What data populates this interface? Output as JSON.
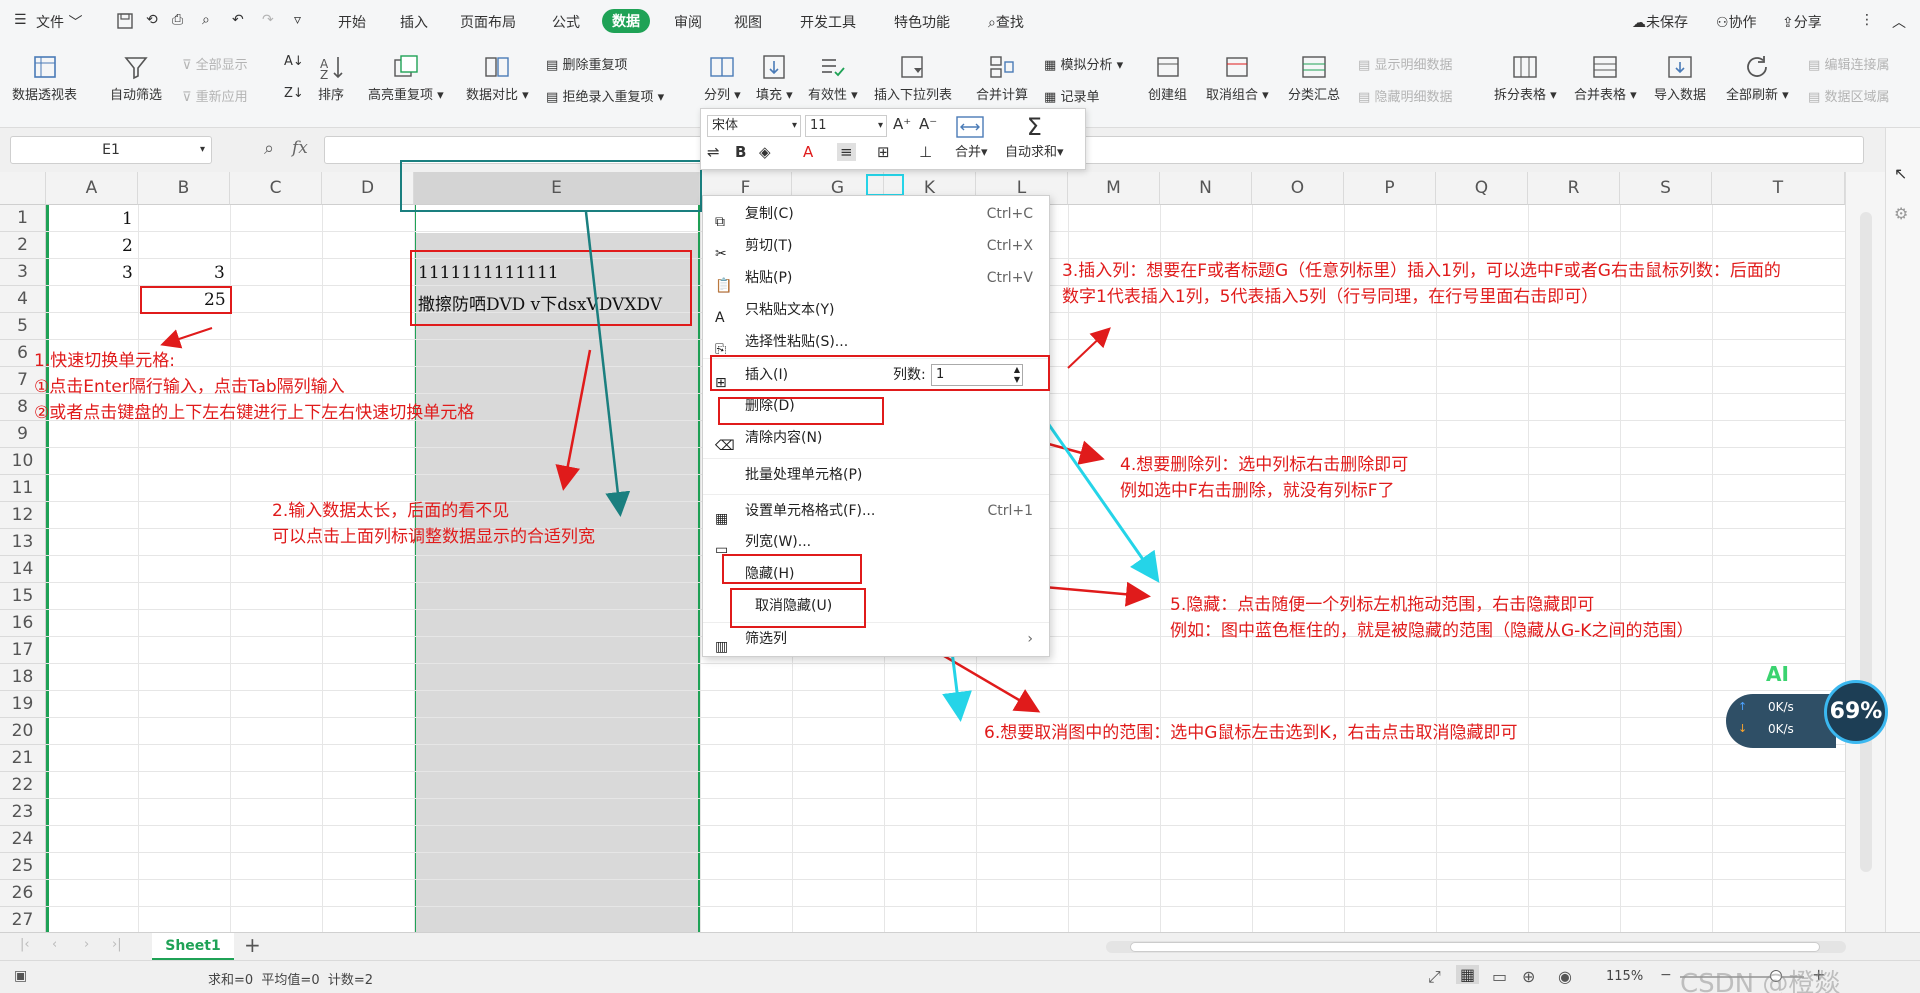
{
  "menu": {
    "file": "文件",
    "tabs": [
      "开始",
      "插入",
      "页面布局",
      "公式",
      "数据",
      "审阅",
      "视图",
      "开发工具",
      "特色功能"
    ],
    "active_tab": "数据",
    "search": "查找",
    "unsaved": "未保存",
    "collab": "协作",
    "share": "分享"
  },
  "ribbon": {
    "pivot": "数据透视表",
    "autofilter": "自动筛选",
    "show_all": "全部显示",
    "reapply": "重新应用",
    "sort": "排序",
    "highlight_dup": "高亮重复项",
    "compare": "数据对比",
    "remove_dup": "删除重复项",
    "reject_dup": "拒绝录入重复项",
    "split": "分列",
    "fill": "填充",
    "validity": "有效性",
    "dropdown": "插入下拉列表",
    "consolidate": "合并计算",
    "simulate": "模拟分析",
    "record": "记录单",
    "group": "创建组",
    "ungroup": "取消组合",
    "subtotal": "分类汇总",
    "show_detail": "显示明细数据",
    "hide_detail": "隐藏明细数据",
    "split_table": "拆分表格",
    "merge_table": "合并表格",
    "import": "导入数据",
    "refresh_all": "全部刷新",
    "edit_links": "编辑连接属",
    "data_range": "数据区域属"
  },
  "formula_bar": {
    "name_box": "E1",
    "fx": "fx",
    "value": ""
  },
  "grid": {
    "columns": [
      "A",
      "B",
      "C",
      "D",
      "E",
      "F",
      "G",
      "K",
      "L",
      "M",
      "N",
      "O",
      "P",
      "Q",
      "R",
      "S",
      "T"
    ],
    "rows": [
      "1",
      "2",
      "3",
      "4",
      "5",
      "6",
      "7",
      "8",
      "9",
      "10",
      "11",
      "12",
      "13",
      "14",
      "15",
      "16",
      "17",
      "18",
      "19",
      "20",
      "21",
      "22",
      "23",
      "24",
      "25",
      "26",
      "27"
    ],
    "cells": {
      "a1": "1",
      "a2": "2",
      "a3": "3",
      "b3": "3",
      "b4": "25",
      "e3": "1111111111111",
      "e4": "撒擦防哂DVD v下dsxVDVXDV"
    }
  },
  "mini_toolbar": {
    "font": "宋体",
    "size": "11",
    "merge": "合并",
    "autosum": "自动求和"
  },
  "context_menu": {
    "copy": "复制(C)",
    "copy_sc": "Ctrl+C",
    "cut": "剪切(T)",
    "cut_sc": "Ctrl+X",
    "paste": "粘贴(P)",
    "paste_sc": "Ctrl+V",
    "paste_text": "只粘贴文本(Y)",
    "paste_special": "选择性粘贴(S)...",
    "insert": "插入(I)",
    "col_count_label": "列数:",
    "col_count": "1",
    "delete": "删除(D)",
    "clear": "清除内容(N)",
    "batch": "批量处理单元格(P)",
    "format": "设置单元格格式(F)...",
    "format_sc": "Ctrl+1",
    "colwidth": "列宽(W)...",
    "hide": "隐藏(H)",
    "unhide": "取消隐藏(U)",
    "filter": "筛选列"
  },
  "notes": {
    "n1_title": "1.快速切换单元格:",
    "n1_l1": "①点击Enter隔行输入，点击Tab隔列输入",
    "n1_l2": "②或者点击键盘的上下左右键进行上下左右快速切换单元格",
    "n2_l1": "2.输入数据太长，后面的看不见",
    "n2_l2": "可以点击上面列标调整数据显示的合适列宽",
    "n3_l1": "3.插入列：想要在F或者标题G（任意列标里）插入1列，可以选中F或者G右击鼠标列数：后面的",
    "n3_l2": "数字1代表插入1列，5代表插入5列（行号同理，在行号里面右击即可）",
    "n4_l1": "4.想要删除列：选中列标右击删除即可",
    "n4_l2": "例如选中F右击删除，就没有列标F了",
    "n5_l1": "5.隐藏：点击随便一个列标左机拖动范围，右击隐藏即可",
    "n5_l2": "例如：图中蓝色框住的，就是被隐藏的范围（隐藏从G-K之间的范围）",
    "n6": "6.想要取消图中的范围：选中G鼠标左击选到K，右击点击取消隐藏即可"
  },
  "sheet_tab": "Sheet1",
  "status": {
    "summary": "求和=0  平均值=0  计数=2",
    "zoom": "115%",
    "watermark": "CSDN @橙燚"
  },
  "net_widget": {
    "ai": "AI",
    "up": "0K/s",
    "down": "0K/s",
    "percent": "69%"
  }
}
